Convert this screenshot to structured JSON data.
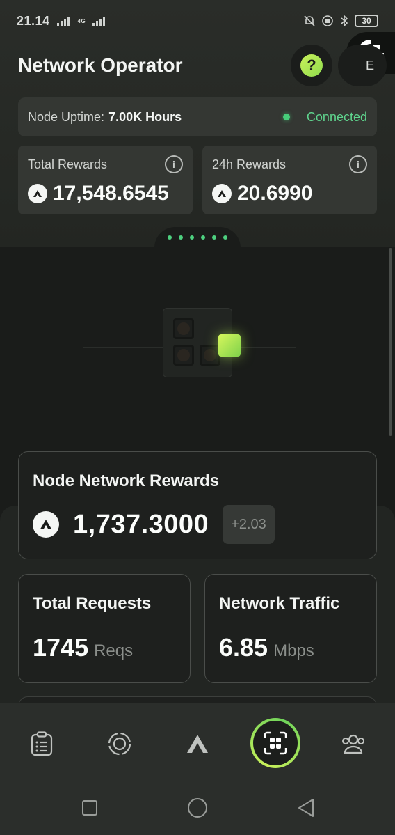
{
  "status_bar": {
    "time": "21.14",
    "network_label": "4G",
    "battery": "30",
    "icons": [
      "signal-icon",
      "mute-bell-icon",
      "data-saver-icon",
      "bluetooth-icon",
      "battery-icon"
    ]
  },
  "header": {
    "title": "Network Operator",
    "help_label": "?",
    "lang_label": "E"
  },
  "uptime": {
    "label": "Node Uptime:",
    "value": "7.00K Hours",
    "status": "Connected"
  },
  "rewards": {
    "total": {
      "label": "Total Rewards",
      "value": "17,548.6545"
    },
    "daily": {
      "label": "24h Rewards",
      "value": "20.6990"
    }
  },
  "pager": {
    "count": 6
  },
  "node_network": {
    "title": "Node Network Rewards",
    "value": "1,737.3000",
    "delta": "+2.03"
  },
  "stats": {
    "requests": {
      "title": "Total Requests",
      "value": "1745",
      "unit": "Reqs"
    },
    "traffic": {
      "title": "Network Traffic",
      "value": "6.85",
      "unit": "Mbps"
    }
  },
  "bottom_nav": {
    "items": [
      "tasks-icon",
      "earth-icon",
      "brand-logo-icon",
      "scan-icon",
      "people-icon"
    ]
  },
  "colors": {
    "accent": "#c9f05a",
    "connected": "#5fd58e",
    "card": "#343733",
    "panel": "#1a1c1a"
  }
}
